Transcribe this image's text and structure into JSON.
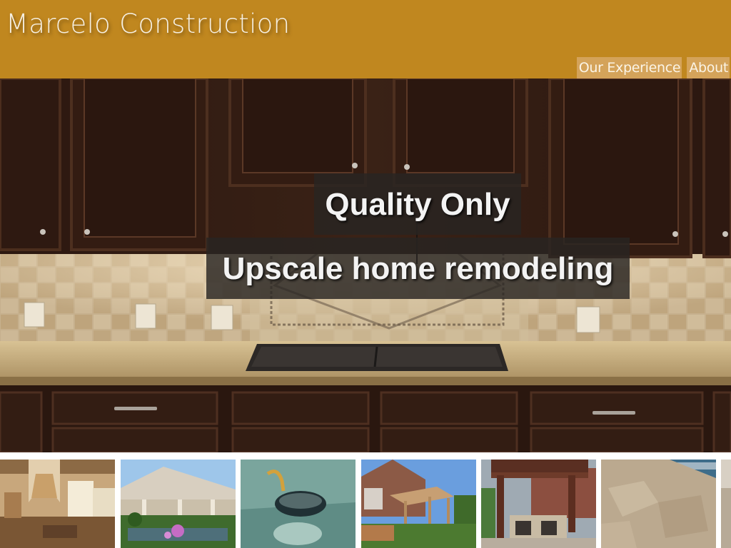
{
  "site": {
    "brand": "Marcelo Construction"
  },
  "nav": {
    "items": [
      {
        "label": "Our Experience"
      },
      {
        "label": "About"
      }
    ]
  },
  "hero": {
    "headline": "Quality Only",
    "subheadline": "Upscale home remodeling"
  },
  "colors": {
    "header_bg": "#c0871f",
    "nav_bg": "#d4a35a",
    "tagline_bg": "#282422"
  },
  "gallery": {
    "thumbnails": [
      {
        "icon": "kitchen-interior-photo"
      },
      {
        "icon": "covered-patio-pond-photo"
      },
      {
        "icon": "glass-vessel-sink-photo"
      },
      {
        "icon": "pergola-construction-photo"
      },
      {
        "icon": "outdoor-kitchen-pergola-photo"
      },
      {
        "icon": "stamped-concrete-photo"
      },
      {
        "icon": "partial-photo"
      }
    ]
  }
}
